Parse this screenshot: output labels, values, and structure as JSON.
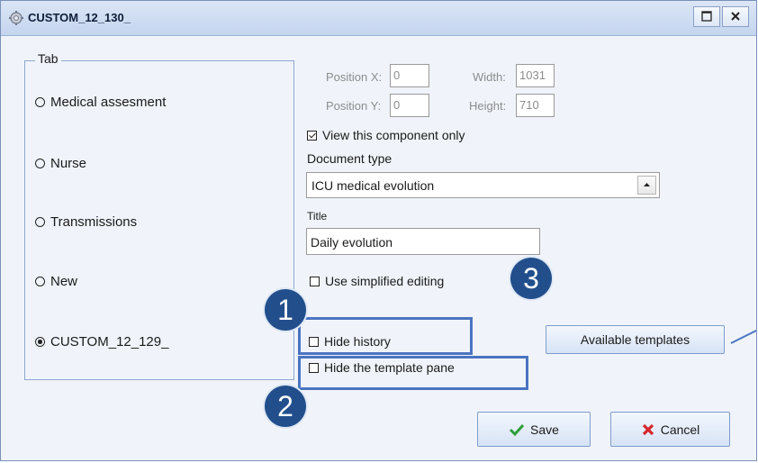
{
  "window": {
    "title": "CUSTOM_12_130_"
  },
  "tab_group": {
    "legend": "Tab",
    "options": [
      {
        "label": "Medical assesment",
        "selected": false
      },
      {
        "label": "Nurse",
        "selected": false
      },
      {
        "label": "Transmissions",
        "selected": false
      },
      {
        "label": "New",
        "selected": false
      },
      {
        "label": "CUSTOM_12_129_",
        "selected": true
      }
    ]
  },
  "geometry_fields": {
    "position_x_label": "Position X:",
    "position_x_value": "0",
    "position_y_label": "Position Y:",
    "position_y_value": "0",
    "width_label": "Width:",
    "width_value": "1031",
    "height_label": "Height:",
    "height_value": "710"
  },
  "view_component_only": {
    "label": "View this component only",
    "checked": true
  },
  "document_type": {
    "label": "Document type",
    "value": "ICU medical evolution"
  },
  "title_field": {
    "label": "Title",
    "value": "Daily evolution"
  },
  "use_simplified_editing": {
    "label": "Use simplified editing",
    "checked": false
  },
  "hide_history": {
    "label": "Hide history",
    "checked": false
  },
  "hide_template_pane": {
    "label": "Hide the template pane",
    "checked": false
  },
  "buttons": {
    "available_templates": "Available templates",
    "save": "Save",
    "cancel": "Cancel"
  },
  "callouts": {
    "one": "1",
    "two": "2",
    "three": "3"
  },
  "colors": {
    "accent": "#224f8c",
    "highlight": "#4a74c1",
    "save_check": "#2e9e3a",
    "cancel_x": "#d6262b"
  }
}
